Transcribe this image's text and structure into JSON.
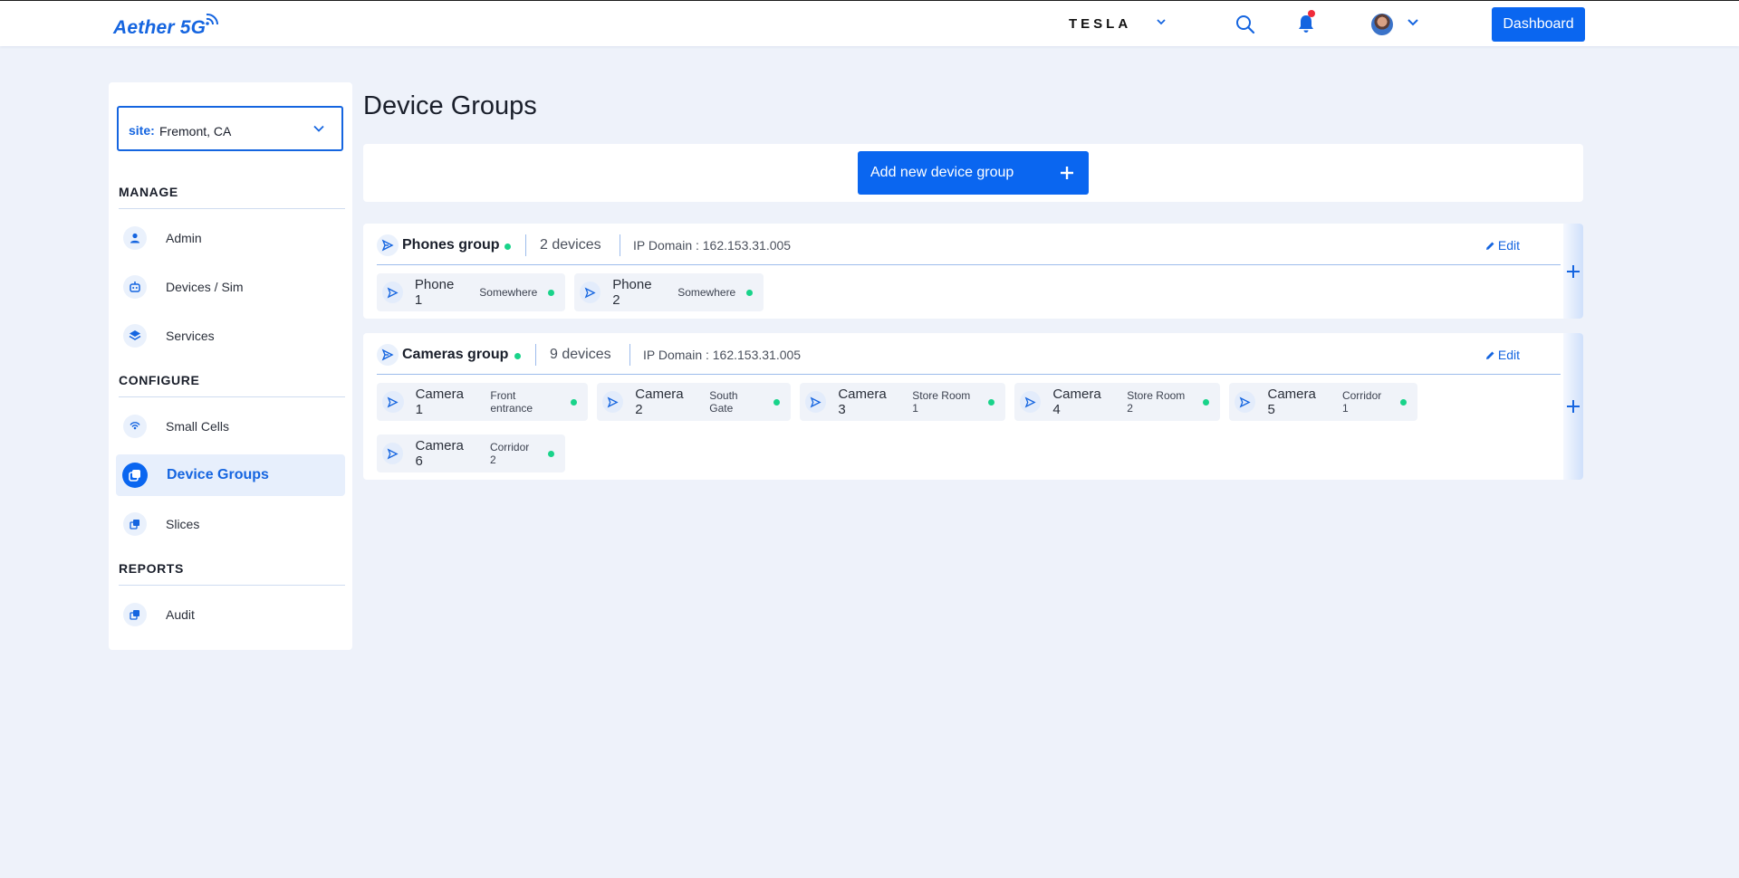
{
  "app": {
    "logo": "Aether 5G"
  },
  "topbar": {
    "brand": "TESLA",
    "dashboard_label": "Dashboard"
  },
  "sidebar": {
    "site_key": "site:",
    "site_value": "Fremont, CA",
    "sections": {
      "manage": "MANAGE",
      "configure": "CONFIGURE",
      "reports": "REPORTS"
    },
    "items": [
      {
        "label": "Admin",
        "icon": "user-icon"
      },
      {
        "label": "Devices / Sim",
        "icon": "robot-icon"
      },
      {
        "label": "Services",
        "icon": "layers-icon"
      },
      {
        "label": "Small Cells",
        "icon": "signal-icon"
      },
      {
        "label": "Device Groups",
        "icon": "device-groups-icon",
        "active": true
      },
      {
        "label": "Slices",
        "icon": "slices-icon"
      },
      {
        "label": "Audit",
        "icon": "audit-icon"
      }
    ]
  },
  "main": {
    "title": "Device Groups",
    "add_label": "Add new device group",
    "edit_label": "Edit",
    "groups": [
      {
        "name": "Phones group",
        "count": "2 devices",
        "ip": "IP Domain : 162.153.31.005",
        "devices": [
          {
            "name": "Phone 1",
            "location": "Somewhere"
          },
          {
            "name": "Phone 2",
            "location": "Somewhere"
          }
        ]
      },
      {
        "name": "Cameras group",
        "count": "9 devices",
        "ip": "IP Domain : 162.153.31.005",
        "devices": [
          {
            "name": "Camera 1",
            "location": "Front entrance"
          },
          {
            "name": "Camera 2",
            "location": "South Gate"
          },
          {
            "name": "Camera 3",
            "location": "Store Room 1"
          },
          {
            "name": "Camera 4",
            "location": "Store Room 2"
          },
          {
            "name": "Camera 5",
            "location": "Corridor 1"
          },
          {
            "name": "Camera 6",
            "location": "Corridor 2"
          }
        ]
      }
    ]
  },
  "colors": {
    "primary": "#0a66f0",
    "status_online": "#19d38a",
    "notification": "#f02b3a",
    "background": "#eef2fa"
  }
}
